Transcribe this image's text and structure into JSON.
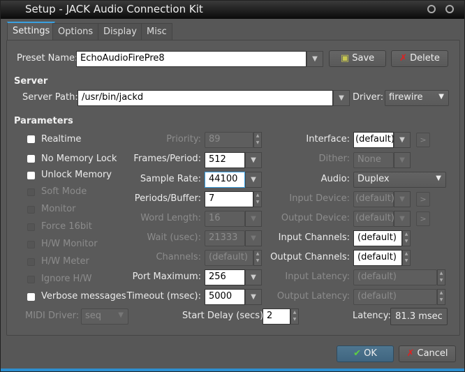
{
  "window": {
    "title": "Setup - JACK Audio Connection Kit"
  },
  "tabs": [
    "Settings",
    "Options",
    "Display",
    "Misc"
  ],
  "preset": {
    "label": "Preset Name:",
    "value": "EchoAudioFirePre8",
    "save": "Save",
    "delete": "Delete"
  },
  "server": {
    "heading": "Server",
    "path_label": "Server Path:",
    "path": "/usr/bin/jackd",
    "driver_label": "Driver:",
    "driver": "firewire"
  },
  "parameters": {
    "heading": "Parameters",
    "checkboxes": [
      {
        "label": "Realtime",
        "checked": false,
        "enabled": true
      },
      {
        "label": "No Memory Lock",
        "checked": false,
        "enabled": true
      },
      {
        "label": "Unlock Memory",
        "checked": false,
        "enabled": true
      },
      {
        "label": "Soft Mode",
        "checked": false,
        "enabled": false
      },
      {
        "label": "Monitor",
        "checked": false,
        "enabled": false
      },
      {
        "label": "Force 16bit",
        "checked": false,
        "enabled": false
      },
      {
        "label": "H/W Monitor",
        "checked": false,
        "enabled": false
      },
      {
        "label": "H/W Meter",
        "checked": false,
        "enabled": false
      },
      {
        "label": "Ignore H/W",
        "checked": false,
        "enabled": false
      },
      {
        "label": "Verbose messages",
        "checked": false,
        "enabled": true
      }
    ],
    "middle": [
      {
        "label": "Priority:",
        "value": "89"
      },
      {
        "label": "Frames/Period:",
        "value": "512"
      },
      {
        "label": "Sample Rate:",
        "value": "44100"
      },
      {
        "label": "Periods/Buffer:",
        "value": "7"
      },
      {
        "label": "Word Length:",
        "value": "16"
      },
      {
        "label": "Wait (usec):",
        "value": "21333"
      },
      {
        "label": "Channels:",
        "value": "(default)"
      },
      {
        "label": "Port Maximum:",
        "value": "256"
      },
      {
        "label": "Timeout (msec):",
        "value": "5000"
      }
    ],
    "right": [
      {
        "label": "Interface:",
        "value": "(default)"
      },
      {
        "label": "Dither:",
        "value": "None"
      },
      {
        "label": "Audio:",
        "value": "Duplex"
      },
      {
        "label": "Input Device:",
        "value": "(default)"
      },
      {
        "label": "Output Device:",
        "value": "(default)"
      },
      {
        "label": "Input Channels:",
        "value": "(default)"
      },
      {
        "label": "Output Channels:",
        "value": "(default)"
      },
      {
        "label": "Input Latency:",
        "value": "(default)"
      },
      {
        "label": "Output Latency:",
        "value": "(default)"
      }
    ],
    "browse": ">",
    "midi_label": "MIDI Driver:",
    "midi": "seq",
    "start_delay_label": "Start Delay (secs):",
    "start_delay": "2",
    "latency_label": "Latency:",
    "latency": "81.3 msec"
  },
  "buttons": {
    "ok": "OK",
    "cancel": "Cancel"
  },
  "colors": {
    "accent": "#3aa0e0",
    "background": "#5a5a5a"
  }
}
